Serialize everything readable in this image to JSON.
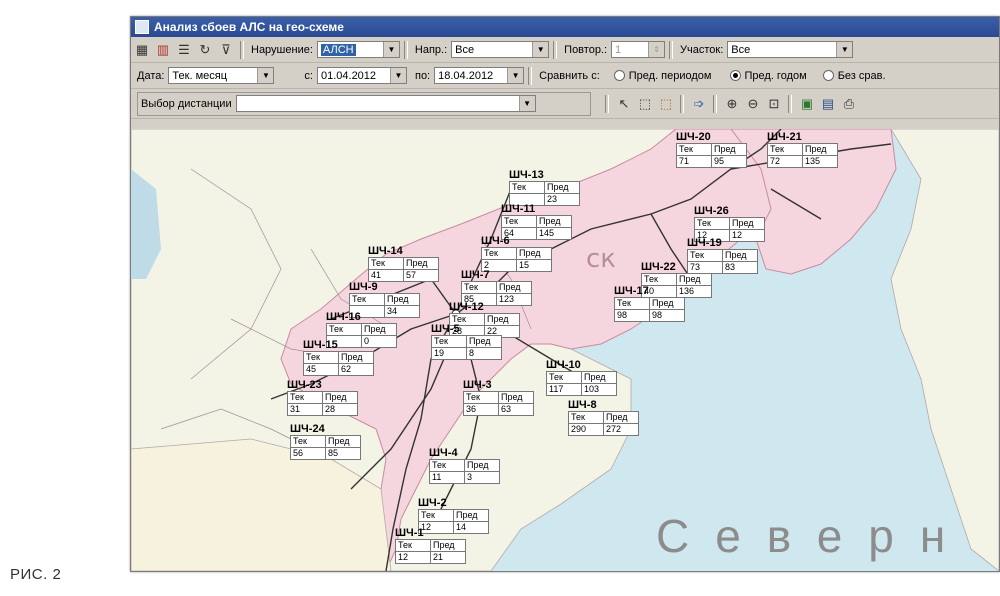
{
  "window": {
    "title": "Анализ сбоев АЛС на гео-схеме"
  },
  "toolbar1": {
    "violation_label": "Нарушение:",
    "violation_value": "АЛСН",
    "direction_label": "Напр.:",
    "direction_value": "Все",
    "repeat_label": "Повтор.:",
    "repeat_value": "1",
    "section_label": "Участок:",
    "section_value": "Все"
  },
  "toolbar2": {
    "date_label": "Дата:",
    "period_value": "Тек. месяц",
    "from_label": "с:",
    "from_value": "01.04.2012",
    "to_label": "по:",
    "to_value": "18.04.2012",
    "compare_label": "Сравнить с:",
    "radio_prev_period": "Пред. периодом",
    "radio_prev_year": "Пред. годом",
    "radio_none": "Без срав.",
    "selected_radio": "prev_year"
  },
  "toolbar3": {
    "distance_label": "Выбор дистанции",
    "distance_value": ""
  },
  "map": {
    "watermark": "Северн",
    "region_text": "ск",
    "col_current": "Тек",
    "col_previous": "Пред",
    "stations": [
      {
        "code": "ШЧ-20",
        "cur": "71",
        "prev": "95"
      },
      {
        "code": "ШЧ-21",
        "cur": "72",
        "prev": "135"
      },
      {
        "code": "ШЧ-13",
        "cur": "",
        "prev": "23"
      },
      {
        "code": "ШЧ-11",
        "cur": "64",
        "prev": "145"
      },
      {
        "code": "ШЧ-26",
        "cur": "12",
        "prev": "12"
      },
      {
        "code": "ШЧ-6",
        "cur": "2",
        "prev": "15"
      },
      {
        "code": "ШЧ-19",
        "cur": "73",
        "prev": "83"
      },
      {
        "code": "ШЧ-14",
        "cur": "41",
        "prev": "57"
      },
      {
        "code": "ШЧ-22",
        "cur": "40",
        "prev": "136"
      },
      {
        "code": "ШЧ-7",
        "cur": "85",
        "prev": "123"
      },
      {
        "code": "ШЧ-9",
        "cur": "",
        "prev": "34"
      },
      {
        "code": "ШЧ-17",
        "cur": "98",
        "prev": "98"
      },
      {
        "code": "ШЧ-12",
        "cur": "28",
        "prev": "22"
      },
      {
        "code": "ШЧ-16",
        "cur": "",
        "prev": "0"
      },
      {
        "code": "ШЧ-5",
        "cur": "19",
        "prev": "8"
      },
      {
        "code": "ШЧ-15",
        "cur": "45",
        "prev": "62"
      },
      {
        "code": "ШЧ-10",
        "cur": "117",
        "prev": "103"
      },
      {
        "code": "ШЧ-23",
        "cur": "31",
        "prev": "28"
      },
      {
        "code": "ШЧ-3",
        "cur": "36",
        "prev": "63"
      },
      {
        "code": "ШЧ-8",
        "cur": "290",
        "prev": "272"
      },
      {
        "code": "ШЧ-24",
        "cur": "56",
        "prev": "85"
      },
      {
        "code": "ШЧ-4",
        "cur": "11",
        "prev": "3"
      },
      {
        "code": "ШЧ-2",
        "cur": "12",
        "prev": "14"
      },
      {
        "code": "ШЧ-1",
        "cur": "12",
        "prev": "21"
      }
    ],
    "colors": {
      "sea": "#cfe7ee",
      "land": "#f3f3e6",
      "region": "#f6d6de",
      "rail": "#333333"
    }
  },
  "caption": "РИС. 2"
}
